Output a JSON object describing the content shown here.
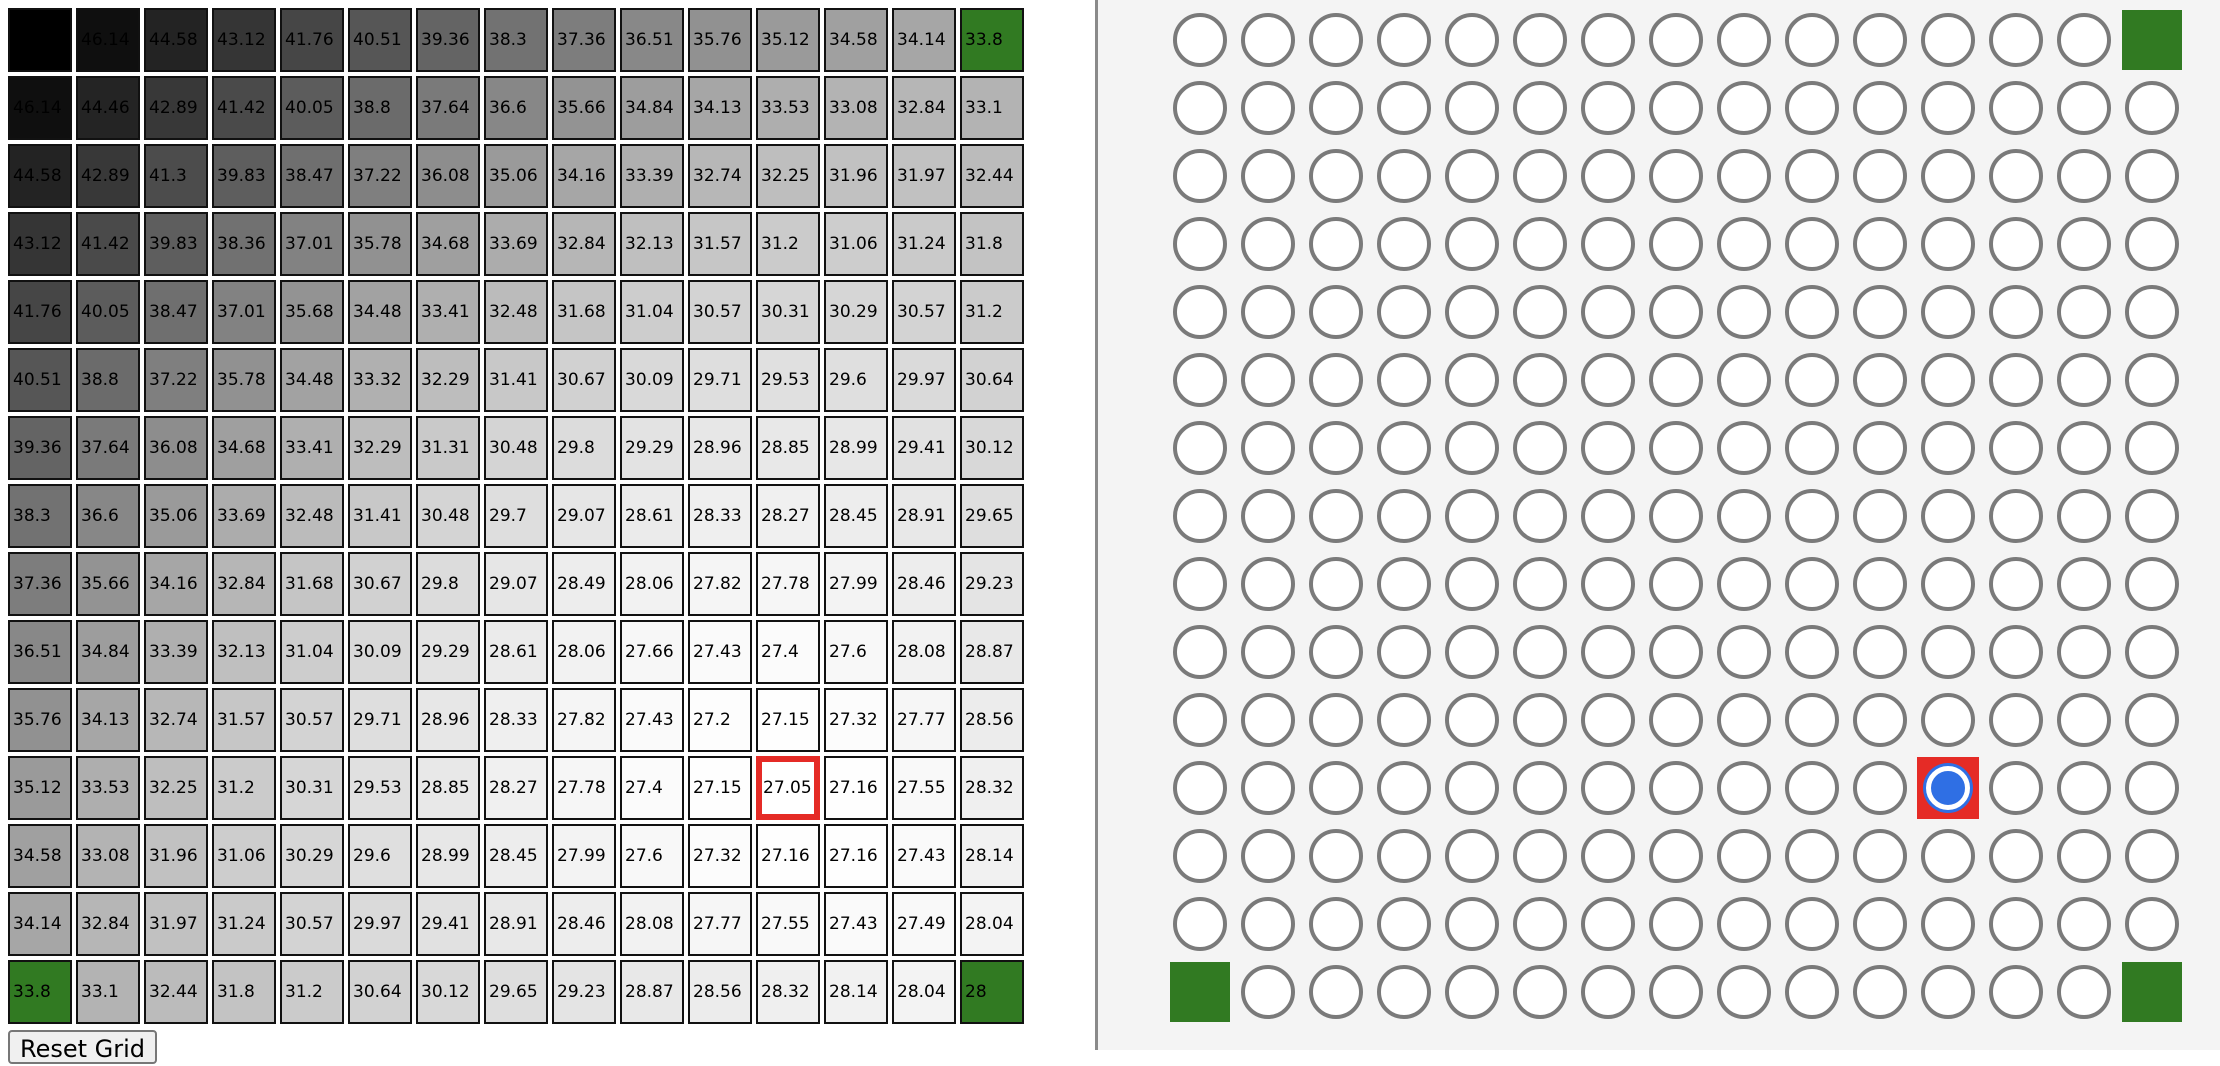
{
  "values": [
    [
      "46.14",
      "46.14",
      "44.58",
      "43.12",
      "41.76",
      "40.51",
      "39.36",
      "38.3",
      "37.36",
      "36.51",
      "35.76",
      "35.12",
      "34.58",
      "34.14",
      "33.8"
    ],
    [
      "46.14",
      "44.46",
      "42.89",
      "41.42",
      "40.05",
      "38.8",
      "37.64",
      "36.6",
      "35.66",
      "34.84",
      "34.13",
      "33.53",
      "33.08",
      "32.84",
      "33.1"
    ],
    [
      "44.58",
      "42.89",
      "41.3",
      "39.83",
      "38.47",
      "37.22",
      "36.08",
      "35.06",
      "34.16",
      "33.39",
      "32.74",
      "32.25",
      "31.96",
      "31.97",
      "32.44"
    ],
    [
      "43.12",
      "41.42",
      "39.83",
      "38.36",
      "37.01",
      "35.78",
      "34.68",
      "33.69",
      "32.84",
      "32.13",
      "31.57",
      "31.2",
      "31.06",
      "31.24",
      "31.8"
    ],
    [
      "41.76",
      "40.05",
      "38.47",
      "37.01",
      "35.68",
      "34.48",
      "33.41",
      "32.48",
      "31.68",
      "31.04",
      "30.57",
      "30.31",
      "30.29",
      "30.57",
      "31.2"
    ],
    [
      "40.51",
      "38.8",
      "37.22",
      "35.78",
      "34.48",
      "33.32",
      "32.29",
      "31.41",
      "30.67",
      "30.09",
      "29.71",
      "29.53",
      "29.6",
      "29.97",
      "30.64"
    ],
    [
      "39.36",
      "37.64",
      "36.08",
      "34.68",
      "33.41",
      "32.29",
      "31.31",
      "30.48",
      "29.8",
      "29.29",
      "28.96",
      "28.85",
      "28.99",
      "29.41",
      "30.12"
    ],
    [
      "38.3",
      "36.6",
      "35.06",
      "33.69",
      "32.48",
      "31.41",
      "30.48",
      "29.7",
      "29.07",
      "28.61",
      "28.33",
      "28.27",
      "28.45",
      "28.91",
      "29.65"
    ],
    [
      "37.36",
      "35.66",
      "34.16",
      "32.84",
      "31.68",
      "30.67",
      "29.8",
      "29.07",
      "28.49",
      "28.06",
      "27.82",
      "27.78",
      "27.99",
      "28.46",
      "29.23"
    ],
    [
      "36.51",
      "34.84",
      "33.39",
      "32.13",
      "31.04",
      "30.09",
      "29.29",
      "28.61",
      "28.06",
      "27.66",
      "27.43",
      "27.4",
      "27.6",
      "28.08",
      "28.87"
    ],
    [
      "35.76",
      "34.13",
      "32.74",
      "31.57",
      "30.57",
      "29.71",
      "28.96",
      "28.33",
      "27.82",
      "27.43",
      "27.2",
      "27.15",
      "27.32",
      "27.77",
      "28.56"
    ],
    [
      "35.12",
      "33.53",
      "32.25",
      "31.2",
      "30.31",
      "29.53",
      "28.85",
      "28.27",
      "27.78",
      "27.4",
      "27.15",
      "27.05",
      "27.16",
      "27.55",
      "28.32"
    ],
    [
      "34.58",
      "33.08",
      "31.96",
      "31.06",
      "30.29",
      "29.6",
      "28.99",
      "28.45",
      "27.99",
      "27.6",
      "27.32",
      "27.16",
      "27.16",
      "27.43",
      "28.14"
    ],
    [
      "34.14",
      "32.84",
      "31.97",
      "31.24",
      "30.57",
      "29.97",
      "29.41",
      "28.91",
      "28.46",
      "28.08",
      "27.77",
      "27.55",
      "27.43",
      "27.49",
      "28.04"
    ],
    [
      "33.8",
      "33.1",
      "32.44",
      "31.8",
      "31.2",
      "30.64",
      "30.12",
      "29.65",
      "29.23",
      "28.87",
      "28.56",
      "28.32",
      "28.14",
      "28.04",
      "28"
    ]
  ],
  "value_scale": {
    "min": 27.05,
    "max": 46.14
  },
  "top_left_cell_color": "#000000",
  "goal_color": "#317a22",
  "agent_color": "#2f6fe4",
  "highlight_color": "#e52b26",
  "goals": [
    [
      0,
      14
    ],
    [
      14,
      0
    ],
    [
      14,
      14
    ]
  ],
  "highlight": [
    11,
    11
  ],
  "reset_label": "Reset Grid"
}
